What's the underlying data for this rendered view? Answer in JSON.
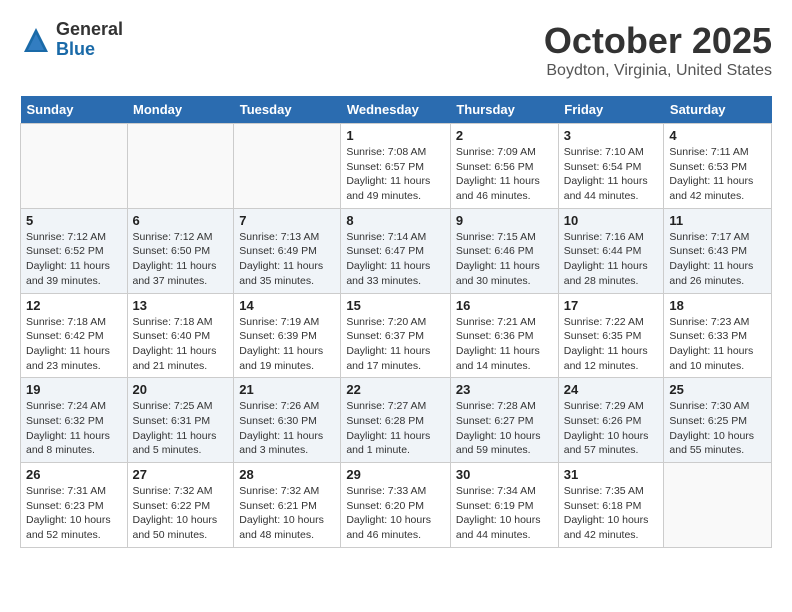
{
  "header": {
    "logo_general": "General",
    "logo_blue": "Blue",
    "month_title": "October 2025",
    "location": "Boydton, Virginia, United States"
  },
  "days_of_week": [
    "Sunday",
    "Monday",
    "Tuesday",
    "Wednesday",
    "Thursday",
    "Friday",
    "Saturday"
  ],
  "weeks": [
    [
      {
        "day": "",
        "info": ""
      },
      {
        "day": "",
        "info": ""
      },
      {
        "day": "",
        "info": ""
      },
      {
        "day": "1",
        "info": "Sunrise: 7:08 AM\nSunset: 6:57 PM\nDaylight: 11 hours and 49 minutes."
      },
      {
        "day": "2",
        "info": "Sunrise: 7:09 AM\nSunset: 6:56 PM\nDaylight: 11 hours and 46 minutes."
      },
      {
        "day": "3",
        "info": "Sunrise: 7:10 AM\nSunset: 6:54 PM\nDaylight: 11 hours and 44 minutes."
      },
      {
        "day": "4",
        "info": "Sunrise: 7:11 AM\nSunset: 6:53 PM\nDaylight: 11 hours and 42 minutes."
      }
    ],
    [
      {
        "day": "5",
        "info": "Sunrise: 7:12 AM\nSunset: 6:52 PM\nDaylight: 11 hours and 39 minutes."
      },
      {
        "day": "6",
        "info": "Sunrise: 7:12 AM\nSunset: 6:50 PM\nDaylight: 11 hours and 37 minutes."
      },
      {
        "day": "7",
        "info": "Sunrise: 7:13 AM\nSunset: 6:49 PM\nDaylight: 11 hours and 35 minutes."
      },
      {
        "day": "8",
        "info": "Sunrise: 7:14 AM\nSunset: 6:47 PM\nDaylight: 11 hours and 33 minutes."
      },
      {
        "day": "9",
        "info": "Sunrise: 7:15 AM\nSunset: 6:46 PM\nDaylight: 11 hours and 30 minutes."
      },
      {
        "day": "10",
        "info": "Sunrise: 7:16 AM\nSunset: 6:44 PM\nDaylight: 11 hours and 28 minutes."
      },
      {
        "day": "11",
        "info": "Sunrise: 7:17 AM\nSunset: 6:43 PM\nDaylight: 11 hours and 26 minutes."
      }
    ],
    [
      {
        "day": "12",
        "info": "Sunrise: 7:18 AM\nSunset: 6:42 PM\nDaylight: 11 hours and 23 minutes."
      },
      {
        "day": "13",
        "info": "Sunrise: 7:18 AM\nSunset: 6:40 PM\nDaylight: 11 hours and 21 minutes."
      },
      {
        "day": "14",
        "info": "Sunrise: 7:19 AM\nSunset: 6:39 PM\nDaylight: 11 hours and 19 minutes."
      },
      {
        "day": "15",
        "info": "Sunrise: 7:20 AM\nSunset: 6:37 PM\nDaylight: 11 hours and 17 minutes."
      },
      {
        "day": "16",
        "info": "Sunrise: 7:21 AM\nSunset: 6:36 PM\nDaylight: 11 hours and 14 minutes."
      },
      {
        "day": "17",
        "info": "Sunrise: 7:22 AM\nSunset: 6:35 PM\nDaylight: 11 hours and 12 minutes."
      },
      {
        "day": "18",
        "info": "Sunrise: 7:23 AM\nSunset: 6:33 PM\nDaylight: 11 hours and 10 minutes."
      }
    ],
    [
      {
        "day": "19",
        "info": "Sunrise: 7:24 AM\nSunset: 6:32 PM\nDaylight: 11 hours and 8 minutes."
      },
      {
        "day": "20",
        "info": "Sunrise: 7:25 AM\nSunset: 6:31 PM\nDaylight: 11 hours and 5 minutes."
      },
      {
        "day": "21",
        "info": "Sunrise: 7:26 AM\nSunset: 6:30 PM\nDaylight: 11 hours and 3 minutes."
      },
      {
        "day": "22",
        "info": "Sunrise: 7:27 AM\nSunset: 6:28 PM\nDaylight: 11 hours and 1 minute."
      },
      {
        "day": "23",
        "info": "Sunrise: 7:28 AM\nSunset: 6:27 PM\nDaylight: 10 hours and 59 minutes."
      },
      {
        "day": "24",
        "info": "Sunrise: 7:29 AM\nSunset: 6:26 PM\nDaylight: 10 hours and 57 minutes."
      },
      {
        "day": "25",
        "info": "Sunrise: 7:30 AM\nSunset: 6:25 PM\nDaylight: 10 hours and 55 minutes."
      }
    ],
    [
      {
        "day": "26",
        "info": "Sunrise: 7:31 AM\nSunset: 6:23 PM\nDaylight: 10 hours and 52 minutes."
      },
      {
        "day": "27",
        "info": "Sunrise: 7:32 AM\nSunset: 6:22 PM\nDaylight: 10 hours and 50 minutes."
      },
      {
        "day": "28",
        "info": "Sunrise: 7:32 AM\nSunset: 6:21 PM\nDaylight: 10 hours and 48 minutes."
      },
      {
        "day": "29",
        "info": "Sunrise: 7:33 AM\nSunset: 6:20 PM\nDaylight: 10 hours and 46 minutes."
      },
      {
        "day": "30",
        "info": "Sunrise: 7:34 AM\nSunset: 6:19 PM\nDaylight: 10 hours and 44 minutes."
      },
      {
        "day": "31",
        "info": "Sunrise: 7:35 AM\nSunset: 6:18 PM\nDaylight: 10 hours and 42 minutes."
      },
      {
        "day": "",
        "info": ""
      }
    ]
  ]
}
